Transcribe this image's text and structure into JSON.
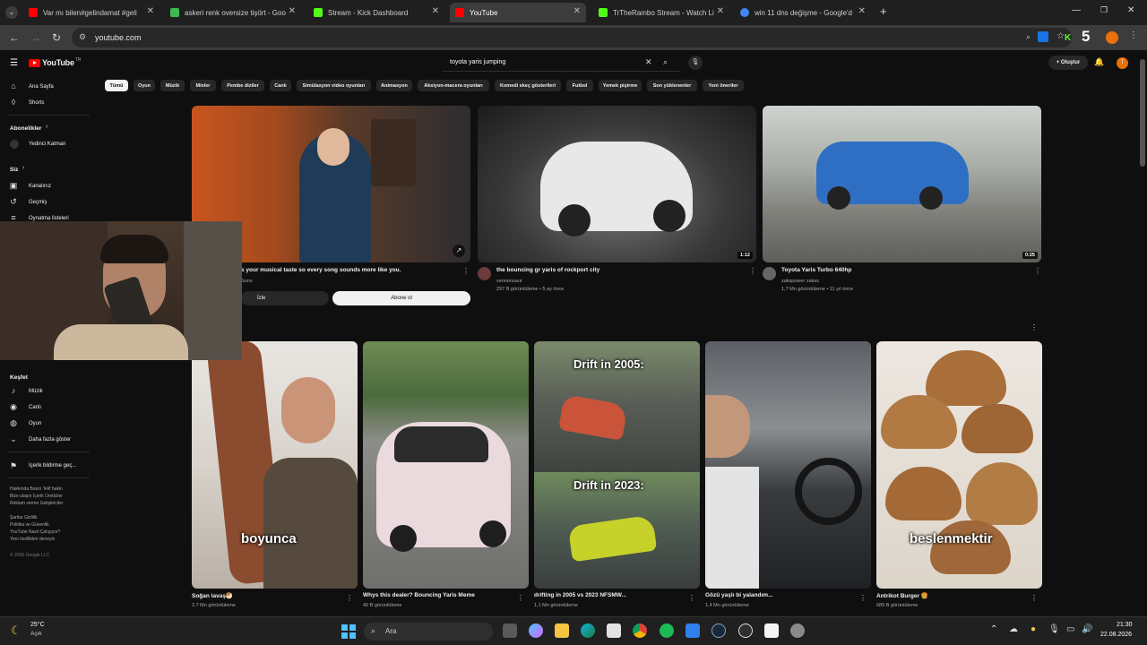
{
  "browser": {
    "tabs": [
      {
        "title": "Var mı bilen#gelindamat #geli",
        "color": "#ff0000"
      },
      {
        "title": "askeri renk oversize tişört - Goo",
        "color": "#3cba54"
      },
      {
        "title": "Stream - Kick Dashboard",
        "color": "#53fc18"
      },
      {
        "title": "YouTube",
        "color": "#ff0000"
      },
      {
        "title": "TrTheRambo Stream - Watch Li",
        "color": "#53fc18"
      },
      {
        "title": "win 11 dns değişme - Google'd",
        "color": "#4285f4"
      }
    ],
    "new_tab": "+",
    "url": "youtube.com",
    "kick_badge": "5"
  },
  "youtube": {
    "logo_text": "YouTube",
    "logo_country": "TR",
    "search_query": "toyota yaris jumping",
    "create_label": "Oluştur",
    "profile_initial": "T",
    "sidebar": {
      "home": "Ana Sayfa",
      "shorts": "Shorts",
      "subscriptions": "Abonelikler",
      "sub_channel": "Yedinci Katman",
      "you": "Siz",
      "channel": "Kanalınız",
      "history": "Geçmiş",
      "playlists": "Oynatma listeleri",
      "explore": "Keşfet",
      "music": "Müzik",
      "live": "Canlı",
      "gaming": "Oyun",
      "show_more": "Daha fazla göster",
      "report": "İçerik bildirme geç...",
      "footer1": "Hakkında  Basın  Telif hakkı",
      "footer2": "Bize ulaşın  İçerik Üreticiler",
      "footer3": "Reklam verme  Geliştiriciler",
      "footer4": "Şartlar  Gizlilik",
      "footer5": "Politika ve Güvenlik",
      "footer6": "YouTube Nasıl Çalışıyor?",
      "footer7": "Yeni özellikleri deneyin",
      "copyright": "© 2026 Google LLC"
    },
    "chips": [
      "Tümü",
      "Oyun",
      "Müzik",
      "Mixler",
      "Pembe diziler",
      "Canlı",
      "Simülasyon video oyunları",
      "Animasyon",
      "Aksiyon-macera oyunları",
      "Komedi skeç gösterileri",
      "Futbol",
      "Yemek pişirme",
      "Son yüklenenler",
      "Yeni öneriler"
    ],
    "videos": [
      {
        "title": "s your musical taste so every song sounds more like you.",
        "channel": "Suno",
        "meta": "",
        "duration": "",
        "btn_watch": "İzle",
        "btn_sub": "Abone ol"
      },
      {
        "title": "the bouncing gr yaris of rockport city",
        "channel": "vennonsaur",
        "meta": "297 B görüntüleme • 5 ay önce",
        "duration": "1:12"
      },
      {
        "title": "Toyota Yaris Turbo 640hp",
        "channel": "zakspower zakss",
        "meta": "1,7 Mn görüntüleme • 11 yıl önce",
        "duration": "0:25"
      }
    ],
    "shorts": [
      {
        "title": "Soğan lavaş🥙",
        "meta": "2,7 Mn görüntüleme",
        "overlay": "boyunca"
      },
      {
        "title": "Whys this dealer? Bouncing Yaris Meme",
        "meta": "40 B görüntüleme",
        "overlay": ""
      },
      {
        "title": "drifting in 2005 vs 2023 NFSMW...",
        "meta": "1,1 Mn görüntüleme",
        "overlay": "Drift in 2005:",
        "overlay2": "Drift in 2023:"
      },
      {
        "title": "Gözü yaşlı bi yalandım...",
        "meta": "1,4 Mn görüntüleme",
        "overlay": ""
      },
      {
        "title": "Antrikot Burger 🍔",
        "meta": "689 B görüntüleme",
        "overlay": "beslenmektir"
      }
    ]
  },
  "taskbar": {
    "weather_temp": "25°C",
    "weather_desc": "Açık",
    "search_label": "Ara",
    "time": "21:30",
    "date": "22.08.2026"
  }
}
